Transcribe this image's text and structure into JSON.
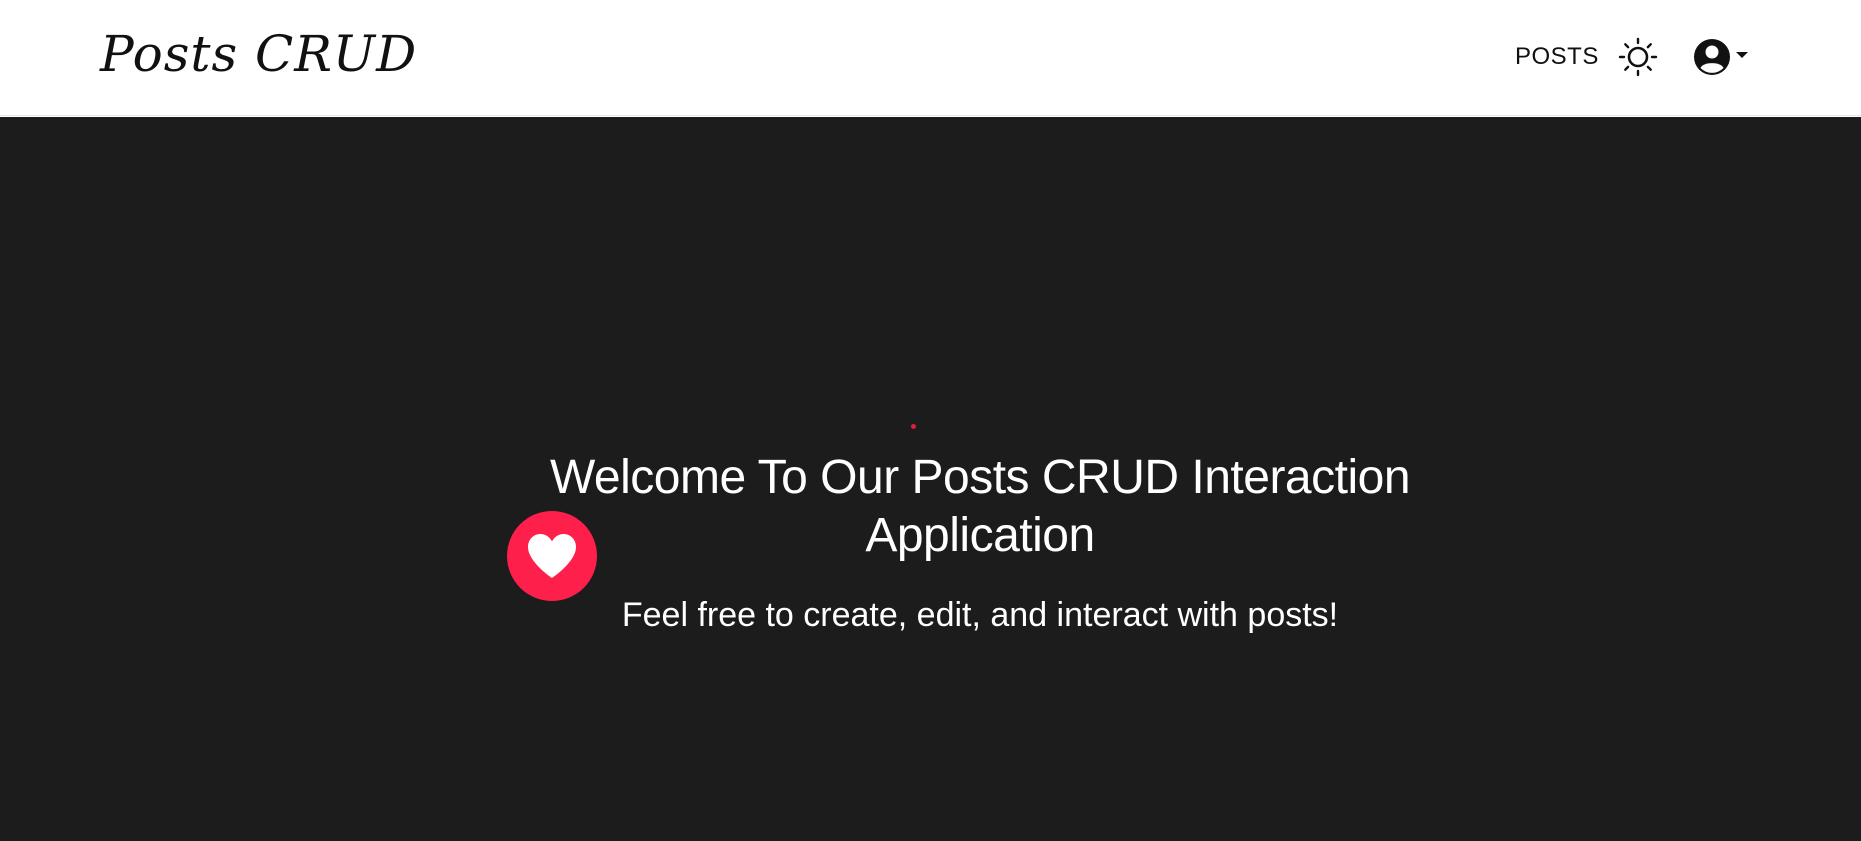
{
  "navbar": {
    "brand": "Posts CRUD",
    "links": [
      {
        "label": "POSTS"
      }
    ],
    "theme_icon": "sun-icon",
    "user_icon": "user-circle-icon",
    "user_dropdown_icon": "caret-down-icon"
  },
  "hero": {
    "title": "Welcome To Our Posts CRUD Interaction Application",
    "subtitle": "Feel free to create, edit, and interact with posts!",
    "like_icon": "heart-icon"
  },
  "colors": {
    "navbar_bg": "#ffffff",
    "hero_bg": "#1c1c1c",
    "accent": "#ff1f4b",
    "text_dark": "#111111",
    "text_light": "#ffffff"
  }
}
